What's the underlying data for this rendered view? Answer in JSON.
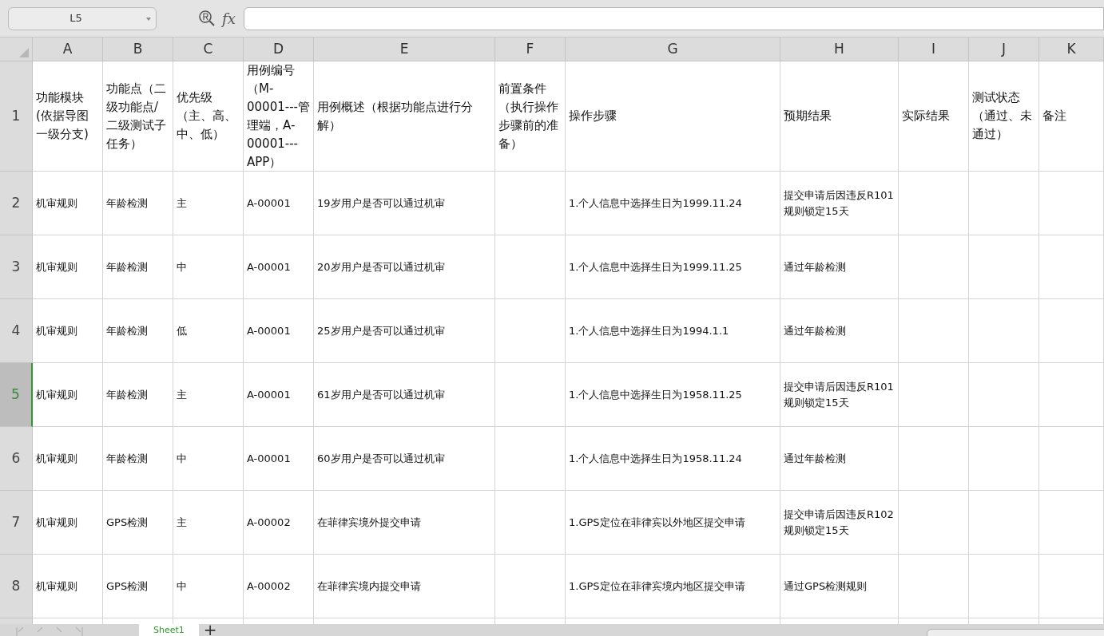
{
  "formula_bar": {
    "name_box": "L5",
    "fx_label": "fx"
  },
  "columns": [
    "A",
    "B",
    "C",
    "D",
    "E",
    "F",
    "G",
    "H",
    "I",
    "J",
    "K"
  ],
  "header_row": {
    "number": "1",
    "selected": false,
    "cells": {
      "A": "功能模块(依据导图一级分支)",
      "B": "功能点（二级功能点/二级测试子任务）",
      "C": "优先级（主、高、中、低）",
      "D": "用例编号（M-00001---管理端，A-00001---APP）",
      "E": "用例概述（根据功能点进行分解）",
      "F": "前置条件（执行操作步骤前的准备）",
      "G": "操作步骤",
      "H": "预期结果",
      "I": "实际结果",
      "J": "测试状态（通过、未通过）",
      "K": "备注"
    }
  },
  "rows": [
    {
      "number": "2",
      "selected": false,
      "cells": {
        "A": "机审规则",
        "B": "年龄检测",
        "C": "主",
        "D": "A-00001",
        "E": "19岁用户是否可以通过机审",
        "G": "1.个人信息中选择生日为1999.11.24",
        "H": "提交申请后因违反R101规则锁定15天"
      }
    },
    {
      "number": "3",
      "selected": false,
      "cells": {
        "A": "机审规则",
        "B": "年龄检测",
        "C": "中",
        "D": "A-00001",
        "E": "20岁用户是否可以通过机审",
        "G": "1.个人信息中选择生日为1999.11.25",
        "H": "通过年龄检测"
      }
    },
    {
      "number": "4",
      "selected": false,
      "cells": {
        "A": "机审规则",
        "B": "年龄检测",
        "C": "低",
        "D": "A-00001",
        "E": "25岁用户是否可以通过机审",
        "G": "1.个人信息中选择生日为1994.1.1",
        "H": "通过年龄检测"
      }
    },
    {
      "number": "5",
      "selected": true,
      "cells": {
        "A": "机审规则",
        "B": "年龄检测",
        "C": "主",
        "D": "A-00001",
        "E": "61岁用户是否可以通过机审",
        "G": "1.个人信息中选择生日为1958.11.25",
        "H": "提交申请后因违反R101规则锁定15天"
      }
    },
    {
      "number": "6",
      "selected": false,
      "cells": {
        "A": "机审规则",
        "B": "年龄检测",
        "C": "中",
        "D": "A-00001",
        "E": "60岁用户是否可以通过机审",
        "G": "1.个人信息中选择生日为1958.11.24",
        "H": "通过年龄检测"
      }
    },
    {
      "number": "7",
      "selected": false,
      "cells": {
        "A": "机审规则",
        "B": "GPS检测",
        "C": "主",
        "D": "A-00002",
        "E": "在菲律宾境外提交申请",
        "G": "1.GPS定位在菲律宾以外地区提交申请",
        "H": "提交申请后因违反R102规则锁定15天"
      }
    },
    {
      "number": "8",
      "selected": false,
      "cells": {
        "A": "机审规则",
        "B": "GPS检测",
        "C": "中",
        "D": "A-00002",
        "E": "在菲律宾境内提交申请",
        "G": "1.GPS定位在菲律宾境内地区提交申请",
        "H": "通过GPS检测规则"
      }
    }
  ],
  "sheet_tabs": [
    {
      "label": "Sheet1",
      "selected": true
    }
  ],
  "add_sheet": "+"
}
